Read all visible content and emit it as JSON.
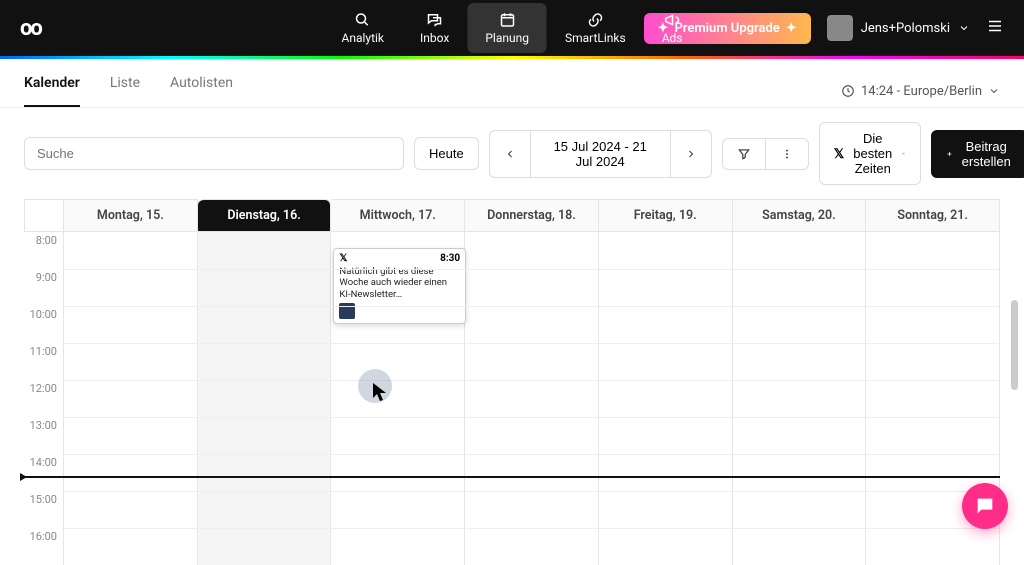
{
  "header": {
    "logo": "∞",
    "nav": [
      {
        "label": "Analytik",
        "icon": "analytics"
      },
      {
        "label": "Inbox",
        "icon": "inbox"
      },
      {
        "label": "Planung",
        "icon": "calendar"
      },
      {
        "label": "SmartLinks",
        "icon": "link"
      },
      {
        "label": "Ads",
        "icon": "megaphone"
      }
    ],
    "premium": "Premium Upgrade",
    "user": "Jens+Polomski"
  },
  "tabs": {
    "items": [
      {
        "label": "Kalender"
      },
      {
        "label": "Liste"
      },
      {
        "label": "Autolisten"
      }
    ],
    "timezone": "14:24 - Europe/Berlin"
  },
  "toolbar": {
    "search_placeholder": "Suche",
    "today": "Heute",
    "date_range": "15 Jul 2024 - 21 Jul 2024",
    "best_times": "Die besten Zeiten",
    "create": "Beitrag erstellen"
  },
  "calendar": {
    "days": [
      "Montag, 15.",
      "Dienstag, 16.",
      "Mittwoch, 17.",
      "Donnerstag, 18.",
      "Freitag, 19.",
      "Samstag, 20.",
      "Sonntag, 21."
    ],
    "hours": [
      "8:00",
      "9:00",
      "10:00",
      "11:00",
      "12:00",
      "13:00",
      "14:00",
      "15:00",
      "16:00"
    ],
    "current_day_index": 1,
    "event": {
      "platform": "𝕏",
      "time": "8:30",
      "text": "Natürlich gibt es diese Woche auch wieder einen KI-Newsletter…"
    }
  }
}
